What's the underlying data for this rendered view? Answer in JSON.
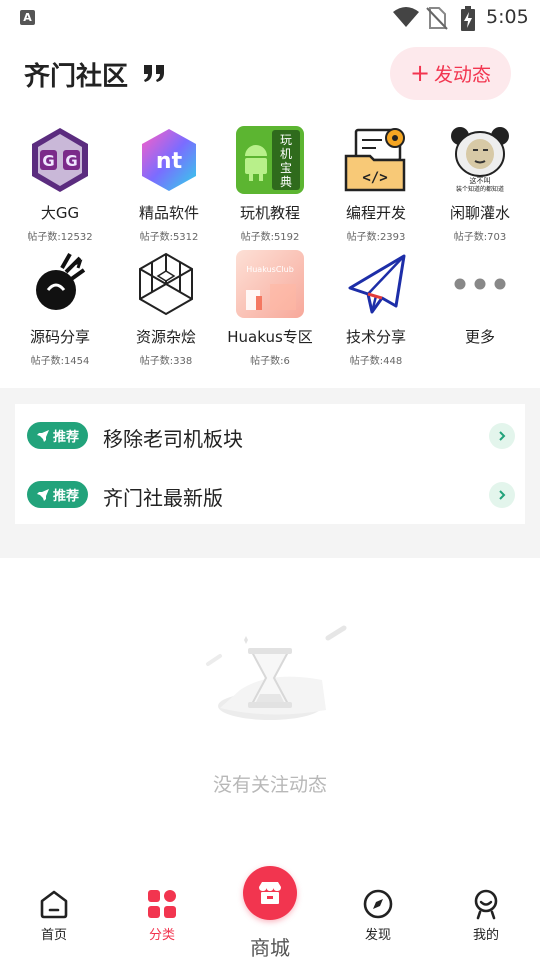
{
  "status_bar": {
    "notification_letter": "A",
    "time": "5:05",
    "icons": [
      "wifi-icon",
      "no-sim-icon",
      "battery-charging-icon"
    ]
  },
  "header": {
    "title": "齐门社区",
    "post_button_label": "发动态",
    "post_button_icon": "plus-icon",
    "accent_color": "#f2354f"
  },
  "categories": [
    {
      "name": "大GG",
      "count": "帖子数:12532",
      "icon": "gg-app-icon"
    },
    {
      "name": "精品软件",
      "count": "帖子数:5312",
      "icon": "nt-app-icon"
    },
    {
      "name": "玩机教程",
      "count": "帖子数:5192",
      "icon": "android-guide-icon",
      "icon_text": [
        "玩",
        "机",
        "宝",
        "典"
      ]
    },
    {
      "name": "编程开发",
      "count": "帖子数:2393",
      "icon": "code-window-icon"
    },
    {
      "name": "闲聊灌水",
      "count": "帖子数:703",
      "icon": "panda-meme-icon",
      "icon_text": [
        "这不叫",
        "装个知道的都知道"
      ]
    },
    {
      "name": "源码分享",
      "count": "帖子数:1454",
      "icon": "source-code-icon"
    },
    {
      "name": "资源杂烩",
      "count": "帖子数:338",
      "icon": "hexagon-cube-icon"
    },
    {
      "name": "Huakus专区",
      "count": "帖子数:6",
      "icon": "huakus-club-icon",
      "icon_text": "HuakusClub"
    },
    {
      "name": "技术分享",
      "count": "帖子数:448",
      "icon": "paper-plane-icon"
    },
    {
      "name": "更多",
      "count": "",
      "icon": "more-dots-icon"
    }
  ],
  "recommended": {
    "badge_label": "推荐",
    "badge_color": "#22a37b",
    "items": [
      {
        "title": "移除老司机板块"
      },
      {
        "title": "齐门社最新版"
      }
    ]
  },
  "empty_state": {
    "text": "没有关注动态",
    "icon": "hourglass-icon"
  },
  "bottom_nav": {
    "items": [
      {
        "label": "首页",
        "icon": "home-icon",
        "active": false
      },
      {
        "label": "分类",
        "icon": "category-grid-icon",
        "active": true
      },
      {
        "label": "商城",
        "icon": "store-icon",
        "active": false
      },
      {
        "label": "发现",
        "icon": "compass-icon",
        "active": false
      },
      {
        "label": "我的",
        "icon": "profile-icon",
        "active": false
      }
    ]
  }
}
